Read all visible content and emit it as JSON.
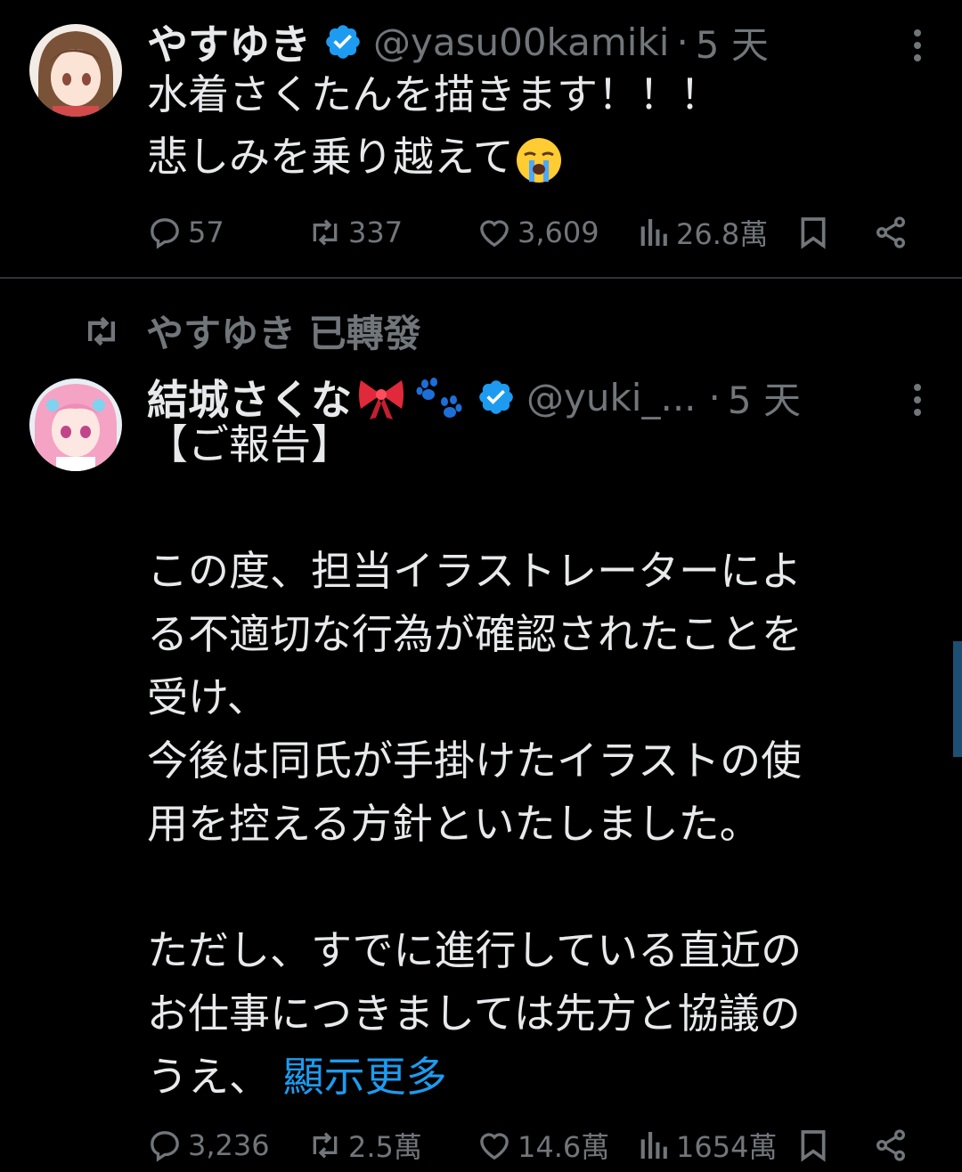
{
  "tweet1": {
    "display_name": "やすゆき",
    "handle": "@yasu00kamiki",
    "separator": "·",
    "time": "5 天",
    "lines": [
      "水着さくたんを描きます！！！",
      "悲しみを乗り越えて"
    ],
    "emoji": "loudly-crying-face-icon",
    "stats": {
      "replies": "57",
      "retweets": "337",
      "likes": "3,609",
      "views": "26.8萬"
    }
  },
  "tweet2": {
    "retweet_context": "やすゆき 已轉發",
    "display_name": "結城さくな",
    "name_emojis": [
      "ribbon-icon",
      "paw-prints-icon"
    ],
    "handle": "@yuki_...",
    "separator": "·",
    "time": "5 天",
    "lines": [
      "【ご報告】",
      "",
      "この度、担当イラストレーターによ",
      "る不適切な行為が確認されたことを",
      "受け、",
      "今後は同氏が手掛けたイラストの使",
      "用を控える方針といたしました。",
      "",
      "ただし、すでに進行している直近の",
      "お仕事につきましては先方と協議の"
    ],
    "last_line_prefix": "うえ、",
    "show_more": "顯示更多",
    "stats": {
      "replies": "3,236",
      "retweets": "2.5萬",
      "likes": "14.6萬",
      "views": "1654萬"
    }
  },
  "colors": {
    "background": "#000000",
    "text": "#e7e9ea",
    "muted": "#71767b",
    "link": "#1d9bf0",
    "verified": "#1d9bf0"
  }
}
